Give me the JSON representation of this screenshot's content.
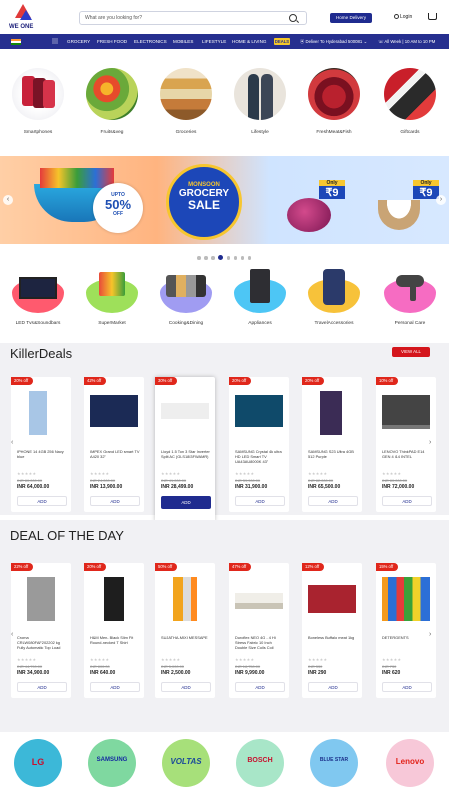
{
  "header": {
    "logo_text": "WE ONE",
    "search_placeholder": "What are you looking for?",
    "home_delivery": "Home Delivery",
    "login": "Login"
  },
  "nav": {
    "items": [
      "GROCERY",
      "FRESH FOOD",
      "ELECTRONICS",
      "MOBILES",
      "LIFESTYLE",
      "HOME & LIVING"
    ],
    "deals": "DEALS",
    "location": "Deliver To Hyderabad 500081",
    "support": "All Week | 10 AM to 10 PM"
  },
  "categories": [
    {
      "label": "Smartphones"
    },
    {
      "label": "Fruits&veg"
    },
    {
      "label": "Groceries"
    },
    {
      "label": "Lifestyle"
    },
    {
      "label": "FreshMeat&Fish"
    },
    {
      "label": "Giftcards"
    }
  ],
  "banner": {
    "upto": "UPTO",
    "pct": "50%",
    "off": "OFF",
    "top": "MONSOON",
    "main": "GROCERY",
    "sale": "SALE",
    "only1": "Only",
    "price1": "₹9",
    "only2": "Only",
    "price2": "₹9"
  },
  "categories2": [
    {
      "label": "LED Tvs&Soundbars",
      "color": "#ff5a6e"
    },
    {
      "label": "SuperMarket",
      "color": "#9ee05a"
    },
    {
      "label": "Cooking&Dining",
      "color": "#a09cf2"
    },
    {
      "label": "Appliances",
      "color": "#4dc6f5"
    },
    {
      "label": "TravelAccessories",
      "color": "#f7c23a"
    },
    {
      "label": "Personal Care",
      "color": "#f66cc2"
    }
  ],
  "killer": {
    "title": "KillerDeals",
    "view_all": "VIEW ALL",
    "products": [
      {
        "badge": "20% off",
        "name": "IPHONE 14 4GB 256 Navy blue",
        "mrp": "INR 80,000.00",
        "price": "INR 64,000.00",
        "add": "ADD"
      },
      {
        "badge": "42% off",
        "name": "IMPEX Grand LED smart TV A420 32\"",
        "mrp": "INR 24,000.00",
        "price": "INR 13,900.00",
        "add": "ADD"
      },
      {
        "badge": "30% off",
        "name": "Lloyd 1.5 Ton 3 Star Inverter Split AC (GLS18I3FWAMR)",
        "mrp": "INR 41,000.00",
        "price": "INR 28,499.00",
        "add": "ADD"
      },
      {
        "badge": "20% off",
        "name": "SAMSUNG Crystal 4k ultra HD LED Smart TV UA43AU8000K 43\"",
        "mrp": "INR 39,900.00",
        "price": "INR 31,900.00",
        "add": "ADD"
      },
      {
        "badge": "20% off",
        "name": "SAMSUNG S23 Ultra 4GB 512 Purple",
        "mrp": "INR 82,000.00",
        "price": "INR 65,500.00",
        "add": "ADD"
      },
      {
        "badge": "10% off",
        "name": "LENOVO ThinkPAD E14 GEN 4 i14 INTEL",
        "mrp": "INR 80,000.00",
        "price": "INR 72,000.00",
        "add": "ADD"
      }
    ]
  },
  "deal_day": {
    "title": "DEAL OF THE DAY",
    "products": [
      {
        "badge": "22% off",
        "name": "Croma CRLW080FAF202202 kg Fully Automatic Top Load Washing Machine",
        "mrp": "INR 44,790.00",
        "price": "INR 34,900.00",
        "add": "ADD"
      },
      {
        "badge": "20% off",
        "name": "H&M Men- Black Slim Fit Round-necked T Shirt",
        "mrp": "INR 800.00",
        "price": "INR 640.00",
        "add": "ADD"
      },
      {
        "badge": "50% off",
        "name": "SUJATHA-MIXI MESSAPE",
        "mrp": "INR 5,000.00",
        "price": "INR 2,500.00",
        "add": "ADD"
      },
      {
        "badge": "47% off",
        "name": "Duroflex NEO 4G - 4 Hi Stress Fabric 10 Inch Double Size Coils Coil Memory Foam Bed Size 42×48",
        "mrp": "INR 18,750.00",
        "price": "INR 9,990.00",
        "add": "ADD"
      },
      {
        "badge": "12% off",
        "name": "Boneless Buffalo meat 1kg",
        "mrp": "INR 330",
        "price": "INR 290",
        "add": "ADD"
      },
      {
        "badge": "15% off",
        "name": "DETERGENTS",
        "mrp": "INR 730",
        "price": "INR 620",
        "add": "ADD"
      }
    ]
  },
  "brands": [
    {
      "name": "LG"
    },
    {
      "name": "SAMSUNG"
    },
    {
      "name": "VOLTAS"
    },
    {
      "name": "BOSCH"
    },
    {
      "name": "BLUE STAR"
    },
    {
      "name": "Lenovo"
    }
  ]
}
